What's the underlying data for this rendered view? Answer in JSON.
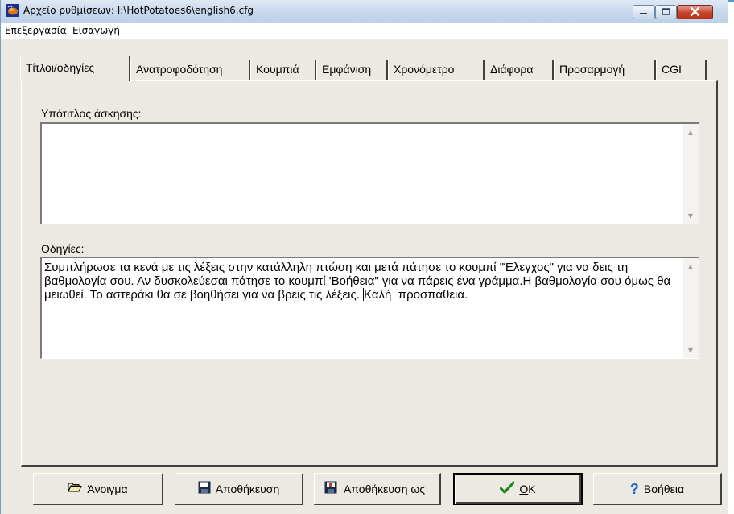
{
  "window": {
    "title": "Αρχείο ρυθμίσεων:  I:\\HotPotatoes6\\english6.cfg"
  },
  "menu": {
    "items": [
      "Επεξεργασία",
      "Εισαγωγή"
    ]
  },
  "tabs": [
    {
      "label": "Τίτλοι/οδηγίες",
      "active": true
    },
    {
      "label": "Ανατροφοδότηση",
      "active": false
    },
    {
      "label": "Κουμπιά",
      "active": false
    },
    {
      "label": "Εμφάνιση",
      "active": false
    },
    {
      "label": "Χρονόμετρο",
      "active": false
    },
    {
      "label": "Διάφορα",
      "active": false
    },
    {
      "label": "Προσαρμογή",
      "active": false
    },
    {
      "label": "CGI",
      "active": false
    }
  ],
  "fields": {
    "subtitle": {
      "label": "Υπότιτλος άσκησης:",
      "value": ""
    },
    "instructions": {
      "label": "Οδηγίες:",
      "value_before_caret": "Συμπλήρωσε τα κενά με τις λέξεις στην κατάλληλη πτώση και μετά πάτησε το κουμπί \"Έλεγχος\" για να δεις τη βαθμολογία σου. Αν δυσκολεύεσαι πάτησε το κουμπί 'Βοήθεια\" για να πάρεις ένα γράμμα.Η βαθμολογία σου όμως θα μειωθεί. Το αστεράκι θα σε βοηθήσει για να βρεις τις λέξεις. ",
      "value_after_caret": "Καλή  προσπάθεια."
    }
  },
  "buttons": {
    "open": {
      "label": "Άνοιγμα",
      "icon": "folder-open-icon"
    },
    "save": {
      "label": "Αποθήκευση",
      "icon": "floppy-disk-icon"
    },
    "save_as": {
      "label": "Αποθήκευση ως",
      "icon": "floppy-save-as-icon"
    },
    "ok": {
      "label_underlined": "O",
      "label_rest": "K",
      "icon": "checkmark-icon"
    },
    "help": {
      "label": "Βοήθεια",
      "icon": "question-mark-icon"
    }
  },
  "colors": {
    "titlebar": "#c9d9ec",
    "window_bg": "#ece9e2",
    "close_button": "#c6452d",
    "checkmark": "#1e8a1e",
    "help_icon": "#1b6ac9"
  }
}
